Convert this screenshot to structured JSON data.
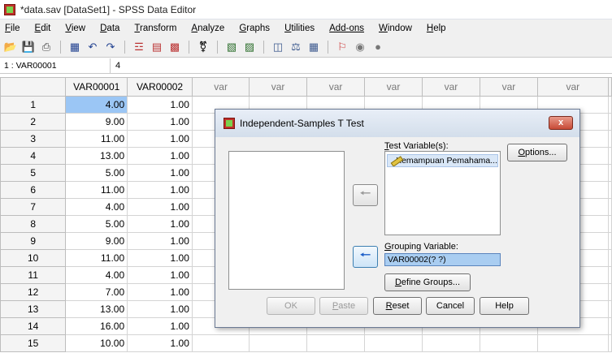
{
  "window": {
    "title": "*data.sav [DataSet1] - SPSS Data Editor"
  },
  "menu": [
    {
      "key": "F",
      "rest": "ile"
    },
    {
      "key": "E",
      "rest": "dit"
    },
    {
      "key": "V",
      "rest": "iew"
    },
    {
      "key": "D",
      "rest": "ata"
    },
    {
      "key": "T",
      "rest": "ransform"
    },
    {
      "key": "A",
      "rest": "nalyze"
    },
    {
      "key": "G",
      "rest": "raphs"
    },
    {
      "key": "U",
      "rest": "tilities"
    },
    {
      "key": "Add-",
      "rest": "ons",
      "underline_rest": true
    },
    {
      "key": "W",
      "rest": "indow"
    },
    {
      "key": "H",
      "rest": "elp"
    }
  ],
  "toolbar_icons": [
    "open-icon",
    "save-icon",
    "print-icon",
    "dialog-recall-icon",
    "undo-icon",
    "redo-icon",
    "goto-case-icon",
    "goto-variable-icon",
    "variables-icon",
    "find-icon",
    "insert-cases-icon",
    "insert-variable-icon",
    "split-file-icon",
    "weight-cases-icon",
    "select-cases-icon",
    "value-labels-icon",
    "use-sets-icon",
    "show-all-icon"
  ],
  "cell_editor": {
    "reference": "1 : VAR00001",
    "value": "4"
  },
  "grid": {
    "columns": [
      "VAR00001",
      "VAR00002",
      "var",
      "var",
      "var",
      "var",
      "var",
      "var",
      "var"
    ],
    "rows": [
      {
        "n": "1",
        "v1": "4.00",
        "v2": "1.00"
      },
      {
        "n": "2",
        "v1": "9.00",
        "v2": "1.00"
      },
      {
        "n": "3",
        "v1": "11.00",
        "v2": "1.00"
      },
      {
        "n": "4",
        "v1": "13.00",
        "v2": "1.00"
      },
      {
        "n": "5",
        "v1": "5.00",
        "v2": "1.00"
      },
      {
        "n": "6",
        "v1": "11.00",
        "v2": "1.00"
      },
      {
        "n": "7",
        "v1": "4.00",
        "v2": "1.00"
      },
      {
        "n": "8",
        "v1": "5.00",
        "v2": "1.00"
      },
      {
        "n": "9",
        "v1": "9.00",
        "v2": "1.00"
      },
      {
        "n": "10",
        "v1": "11.00",
        "v2": "1.00"
      },
      {
        "n": "11",
        "v1": "4.00",
        "v2": "1.00"
      },
      {
        "n": "12",
        "v1": "7.00",
        "v2": "1.00"
      },
      {
        "n": "13",
        "v1": "13.00",
        "v2": "1.00"
      },
      {
        "n": "14",
        "v1": "16.00",
        "v2": "1.00"
      },
      {
        "n": "15",
        "v1": "10.00",
        "v2": "1.00"
      }
    ]
  },
  "dialog": {
    "title": "Independent-Samples T Test",
    "close": "x",
    "test_variables_label": {
      "key": "T",
      "rest": "est Variable(s):"
    },
    "test_variables": [
      "Kemampuan Pemahama..."
    ],
    "grouping_label": {
      "key": "G",
      "rest": "rouping Variable:"
    },
    "grouping_value": "VAR00002(? ?)",
    "options_button": {
      "key": "O",
      "rest": "ptions..."
    },
    "define_groups_button": {
      "key": "D",
      "rest": "efine Groups..."
    },
    "ok_button": "OK",
    "paste_button": {
      "key": "P",
      "rest": "aste"
    },
    "reset_button": {
      "key": "R",
      "rest": "eset"
    },
    "cancel_button": "Cancel",
    "help_button": "Help"
  }
}
